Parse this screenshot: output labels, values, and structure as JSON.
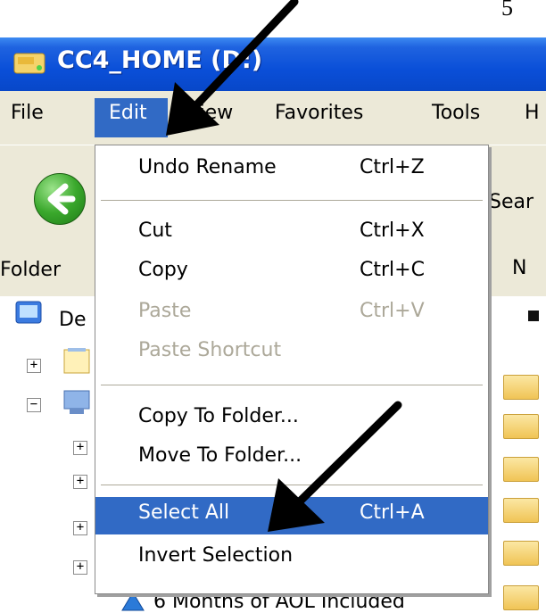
{
  "page_number": "5",
  "window": {
    "title": "CC4_HOME (D:)"
  },
  "menubar": [
    {
      "label": "File"
    },
    {
      "label": "Edit"
    },
    {
      "label": "View"
    },
    {
      "label": "Favorites"
    },
    {
      "label": "Tools"
    },
    {
      "label": "H"
    }
  ],
  "toolbar": {
    "search_fragment": "Sear"
  },
  "left_pane": {
    "folders_label": "Folder",
    "desktop_label": "De"
  },
  "right_pane": {
    "column_label": "N"
  },
  "edit_menu": {
    "items": [
      {
        "label": "Undo Rename",
        "shortcut": "Ctrl+Z"
      },
      {
        "label": "Cut",
        "shortcut": "Ctrl+X"
      },
      {
        "label": "Copy",
        "shortcut": "Ctrl+C"
      },
      {
        "label": "Paste",
        "shortcut": "Ctrl+V"
      },
      {
        "label": "Paste Shortcut",
        "shortcut": ""
      },
      {
        "label": "Copy To Folder...",
        "shortcut": ""
      },
      {
        "label": "Move To Folder...",
        "shortcut": ""
      },
      {
        "label": "Select All",
        "shortcut": "Ctrl+A"
      },
      {
        "label": "Invert Selection",
        "shortcut": ""
      }
    ]
  },
  "footer_item": {
    "label": "6 Months of AOL Included"
  },
  "colors": {
    "title_bar": "#0a4fd8",
    "selection": "#316ac5",
    "menu_bg": "#ece9d8",
    "disabled_text": "#aca899"
  }
}
